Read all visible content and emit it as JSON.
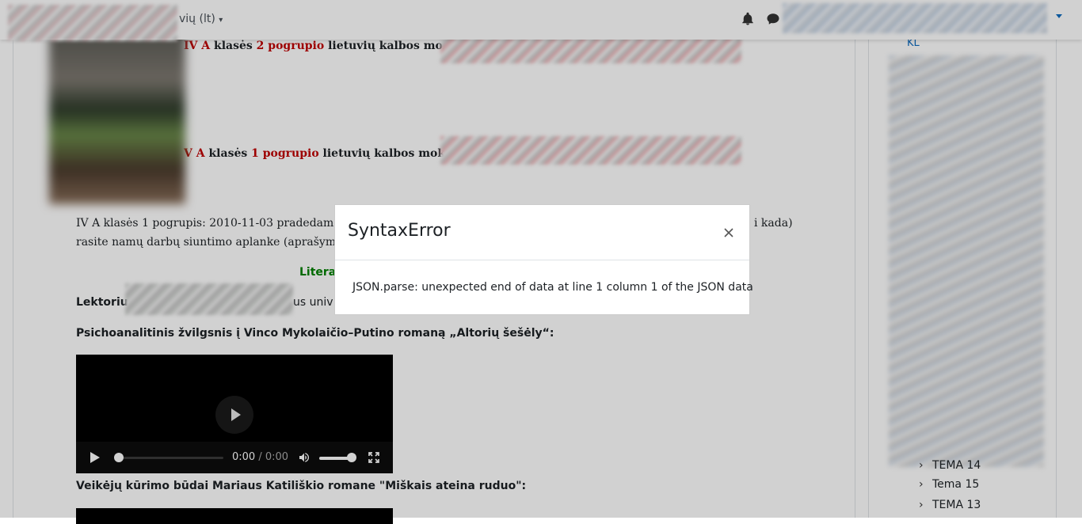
{
  "navbar": {
    "language": "vių (lt)",
    "icons": [
      "bell-icon",
      "chat-icon",
      "chevron-down-icon"
    ]
  },
  "main": {
    "line1": {
      "a": "IV A",
      "b": " klasės ",
      "c": "2 pogrupio",
      "d": " lietuvių kalbos mokytoja:"
    },
    "line2": {
      "a": "V A",
      "b": " klasės ",
      "c": "1 pogrupio",
      "d": " lietuvių kalbos mokytoja"
    },
    "paragraph_line1": "IV A klasės 1 pogrupis: 2010-11-03 pradedame m",
    "paragraph_tail": "i kada)",
    "paragraph_line2": "rasite namų darbų siuntimo aplanke (aprašyme), e",
    "literature_label": "Litera",
    "lecturer_label": "Lektorius",
    "lecturer_tail": "us univ",
    "video1_heading": "Psichoanalitinis žvilgsnis į Vinco Mykolaičio–Putino romaną „Altorių šešėly“:",
    "video2_heading": "Veikėjų kūrimo būdai Mariaus Katiliškio romane \"Miškais ateina ruduo\":",
    "video": {
      "current_time": "0:00",
      "separator": " / ",
      "duration": "0:00",
      "progress": 0.0,
      "volume": 1.0
    }
  },
  "drawer": {
    "top_label": "KL",
    "items": [
      {
        "label": "TEMA 14"
      },
      {
        "label": "Tema 15"
      },
      {
        "label": "TEMA 13"
      }
    ]
  },
  "modal": {
    "title": "SyntaxError",
    "message": "JSON.parse: unexpected end of data at line 1 column 1 of the JSON data"
  },
  "colors": {
    "accent": "#0f6cbf",
    "red_text": "#c00000",
    "green_text": "#008000"
  }
}
